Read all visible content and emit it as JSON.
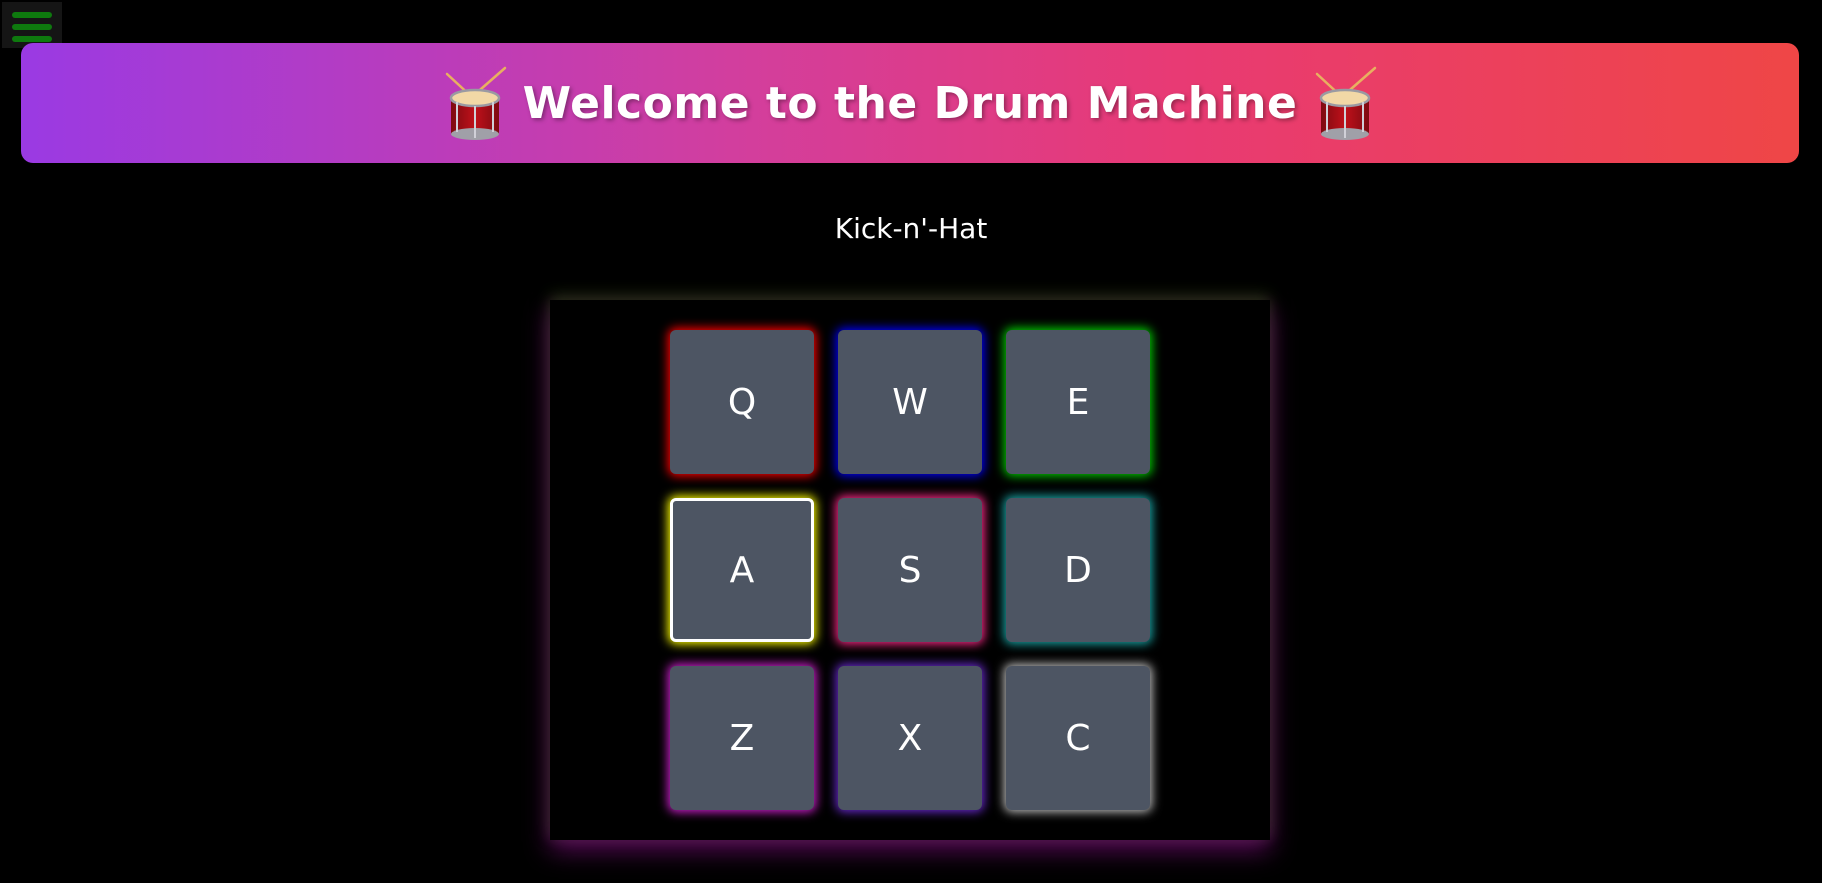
{
  "menu": {
    "icon": "hamburger-menu-icon",
    "color": "#0e7a0e"
  },
  "banner": {
    "title": "Welcome to the Drum Machine",
    "left_icon": "drum-emoji-icon",
    "right_icon": "drum-emoji-icon",
    "gradient": [
      "#9a3ae3",
      "#d23e9e",
      "#e83a74",
      "#ef4646"
    ]
  },
  "display": {
    "preset_name": "Kick-n'-Hat"
  },
  "pads": [
    {
      "key": "Q",
      "glow": "#ff0000",
      "active": false
    },
    {
      "key": "W",
      "glow": "#0000ff",
      "active": false
    },
    {
      "key": "E",
      "glow": "#00d000",
      "active": false
    },
    {
      "key": "A",
      "glow": "#ffff00",
      "active": true
    },
    {
      "key": "S",
      "glow": "#ff2a8a",
      "active": false
    },
    {
      "key": "D",
      "glow": "#1aa7a7",
      "active": false
    },
    {
      "key": "Z",
      "glow": "#d020d0",
      "active": false
    },
    {
      "key": "X",
      "glow": "#6a2ad0",
      "active": false
    },
    {
      "key": "C",
      "glow": "#bfbfbf",
      "active": false
    }
  ]
}
